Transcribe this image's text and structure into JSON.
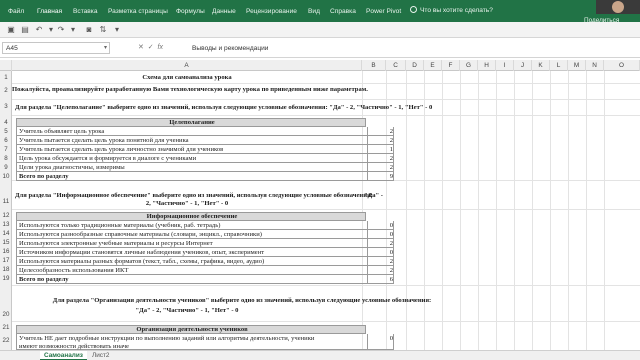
{
  "ribbon": {
    "tabs": [
      "Файл",
      "Главная",
      "Вставка",
      "Разметка страницы",
      "Формулы",
      "Данные",
      "Рецензирование",
      "Вид",
      "Справка",
      "Power Pivot"
    ],
    "tell_me": "Что вы хотите сделать?",
    "share": "Поделиться"
  },
  "formula_bar": {
    "name_box": "A45",
    "formula": "Выводы и рекомендации"
  },
  "columns": [
    "A",
    "B",
    "C",
    "D",
    "E",
    "F",
    "G",
    "H",
    "I",
    "J",
    "K",
    "L",
    "M",
    "N",
    "O"
  ],
  "rows": [
    "1",
    "2",
    "3",
    "4",
    "5",
    "6",
    "7",
    "8",
    "9",
    "10",
    "11",
    "12",
    "13",
    "14",
    "15",
    "16",
    "17",
    "18",
    "19",
    "20",
    "21",
    "22"
  ],
  "sheet": {
    "title": "Схема для самоанализа урока",
    "intro": "Пожалуйста, проанализируйте разработанную Вами технологическую карту урока по приведенным ниже параметрам.",
    "sections": [
      {
        "prompt": "Для раздела \"Целеполагание\" выберите одно из значений, используя следующие условные обозначения: \"Да\" - 2, \"Частично\" - 1, \"Нет\" - 0",
        "header": "Целеполагание",
        "items": [
          {
            "label": "Учитель объявляет цель урока",
            "value": "2"
          },
          {
            "label": "Учитель пытается сделать цель урока понятной для ученика",
            "value": "2"
          },
          {
            "label": "Учитель пытается сделать цель урока личностно значимой для учеников",
            "value": "1"
          },
          {
            "label": "Цель урока обсуждается и формируется в диалоге с учениками",
            "value": "2"
          },
          {
            "label": "Цели урока диагностичны, измеримы",
            "value": "2"
          }
        ],
        "total_label": "Всего по разделу",
        "total": "9"
      },
      {
        "prompt_line1": "Для раздела \"Информационное обеспечение\" выберите одно из значений, используя следующие условные обозначения:",
        "prompt_line1_tail": "\"Да\" -",
        "prompt_line2": "2, \"Частично\" - 1, \"Нет\" - 0",
        "header": "Информационное обеспечение",
        "items": [
          {
            "label": "Используются только традиционные материалы (учебник, раб. тетрадь)",
            "value": "0"
          },
          {
            "label": "Используются разнообразные справочные материалы (словари, энцикл., справочники)",
            "value": "0"
          },
          {
            "label": "Используются электронные учебные материалы и ресурсы Интернет",
            "value": "2"
          },
          {
            "label": "Источником информации становятся личные наблюдения учеников, опыт, эксперимент",
            "value": "0"
          },
          {
            "label": "Используются материалы разных форматов (текст, табл., схемы, графика, видео, аудио)",
            "value": "2"
          },
          {
            "label": "Целесообразность использования ИКТ",
            "value": "2"
          }
        ],
        "total_label": "Всего по разделу",
        "total": "6"
      },
      {
        "prompt_line1": "Для раздела \"Организация деятельности учеников\" выберите одно из значений, используя следующие условные обозначения:",
        "prompt_line2": "\"Да\" - 2, \"Частично\" - 1, \"Нет\" - 0",
        "header": "Организация деятельности учеников",
        "item_line1": "Учитель НЕ дает подробные инструкции по выполнению заданий или алгоритмы деятельности, ученики",
        "item_line2": "имеют возможности действовать иначе",
        "value": "0"
      }
    ]
  },
  "sheet_tabs": [
    "Самоанализ",
    "Лист2"
  ]
}
